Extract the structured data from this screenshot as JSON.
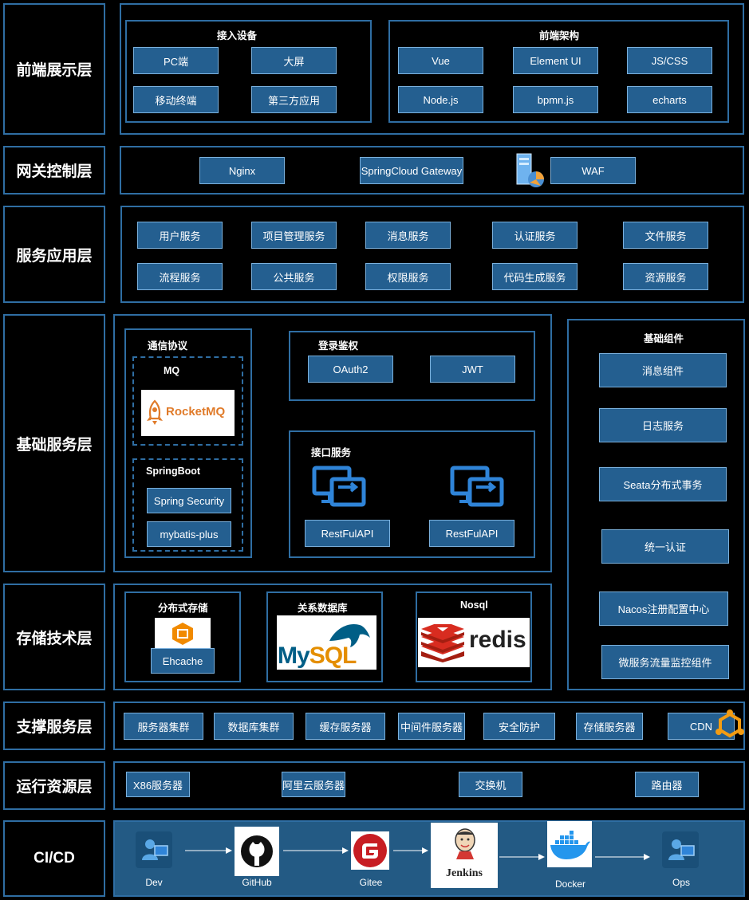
{
  "layers": {
    "frontend": "前端展示层",
    "gateway": "网关控制层",
    "service": "服务应用层",
    "base": "基础服务层",
    "storage": "存储技术层",
    "support": "支撑服务层",
    "runtime": "运行资源层",
    "cicd": "CI/CD"
  },
  "frontend": {
    "devices_title": "接入设备",
    "devices": [
      "PC端",
      "大屏",
      "移动终端",
      "第三方应用"
    ],
    "arch_title": "前端架构",
    "arch": [
      "Vue",
      "Element UI",
      "JS/CSS",
      "Node.js",
      "bpmn.js",
      "echarts"
    ]
  },
  "gateway": {
    "items": [
      "Nginx",
      "SpringCloud Gateway",
      "WAF"
    ]
  },
  "service": {
    "items": [
      "用户服务",
      "项目管理服务",
      "消息服务",
      "认证服务",
      "文件服务",
      "流程服务",
      "公共服务",
      "权限服务",
      "代码生成服务",
      "资源服务"
    ]
  },
  "base": {
    "comm_title": "通信协议",
    "mq_title": "MQ",
    "rocketmq": "RocketMQ",
    "springboot_title": "SpringBoot",
    "springboot_items": [
      "Spring Security",
      "mybatis-plus"
    ],
    "auth_title": "登录鉴权",
    "auth_items": [
      "OAuth2",
      "JWT"
    ],
    "api_title": "接口服务",
    "api_items": [
      "RestFulAPI",
      "RestFulAPI"
    ],
    "components_title": "基础组件",
    "components": [
      "消息组件",
      "日志服务",
      "Seata分布式事务",
      "统一认证",
      "Nacos注册配置中心",
      "微服务流量监控组件"
    ]
  },
  "storage": {
    "dist_title": "分布式存储",
    "dist_item": "Ehcache",
    "rel_title": "关系数据库",
    "mysql": "MySQL",
    "nosql_title": "Nosql",
    "redis": "redis"
  },
  "support": {
    "items": [
      "服务器集群",
      "数据库集群",
      "缓存服务器",
      "中间件服务器",
      "安全防护",
      "存储服务器",
      "CDN"
    ]
  },
  "runtime": {
    "items": [
      "X86服务器",
      "阿里云服务器",
      "交换机",
      "路由器"
    ]
  },
  "cicd": {
    "steps": [
      "Dev",
      "GitHub",
      "Gitee",
      "Jenkins",
      "Docker",
      "Ops"
    ],
    "jenkins_logo_text": "Jenkins"
  },
  "colors": {
    "border": "#2f6ea3",
    "button": "#245f90",
    "button_border": "#7bb1dd",
    "rocketmq": "#e07b2a",
    "mysql_blue": "#005e86",
    "mysql_orange": "#e48e00",
    "redis_red": "#d82c20",
    "gitee_red": "#c71d23"
  }
}
